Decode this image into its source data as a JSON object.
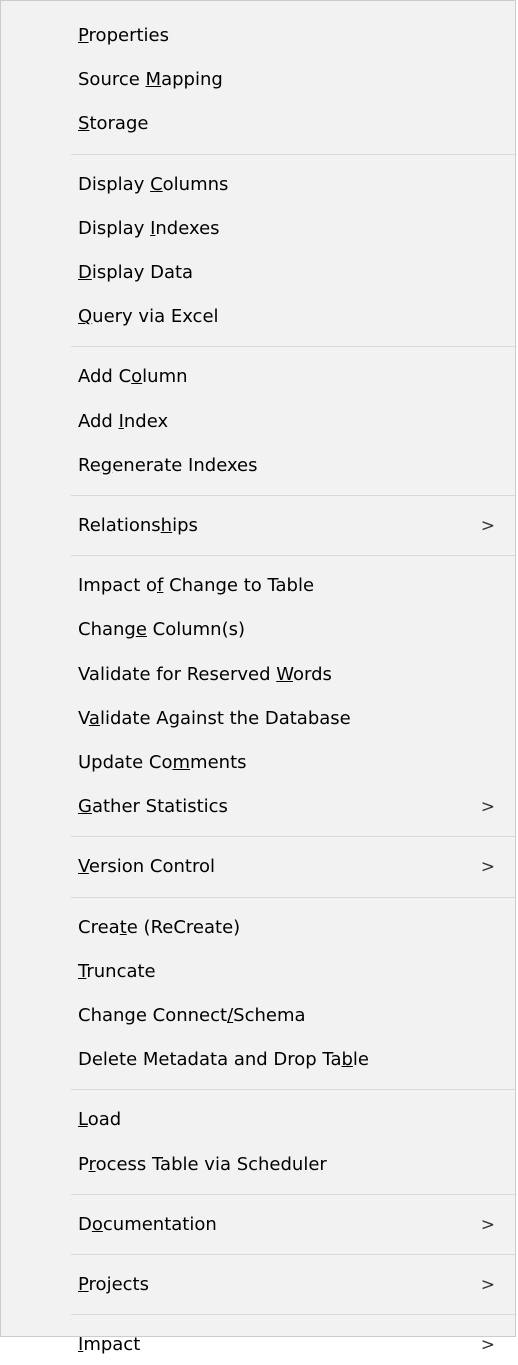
{
  "menu": {
    "groups": [
      {
        "items": [
          {
            "pre": "",
            "key": "P",
            "post": "roperties",
            "submenu": false,
            "arrow": ""
          },
          {
            "pre": "Source ",
            "key": "M",
            "post": "apping",
            "submenu": false,
            "arrow": ""
          },
          {
            "pre": "",
            "key": "S",
            "post": "torage",
            "submenu": false,
            "arrow": ""
          }
        ]
      },
      {
        "items": [
          {
            "pre": "Display ",
            "key": "C",
            "post": "olumns",
            "submenu": false,
            "arrow": ""
          },
          {
            "pre": "Display ",
            "key": "I",
            "post": "ndexes",
            "submenu": false,
            "arrow": ""
          },
          {
            "pre": "",
            "key": "D",
            "post": "isplay Data",
            "submenu": false,
            "arrow": ""
          },
          {
            "pre": "",
            "key": "Q",
            "post": "uery via Excel",
            "submenu": false,
            "arrow": ""
          }
        ]
      },
      {
        "items": [
          {
            "pre": "Add C",
            "key": "o",
            "post": "lumn",
            "submenu": false,
            "arrow": ""
          },
          {
            "pre": "Add ",
            "key": "I",
            "post": "ndex",
            "submenu": false,
            "arrow": ""
          },
          {
            "pre": "Re",
            "key": "g",
            "post": "enerate Indexes",
            "submenu": false,
            "arrow": ""
          }
        ]
      },
      {
        "items": [
          {
            "pre": "Relations",
            "key": "h",
            "post": "ips",
            "submenu": true,
            "arrow": ">"
          }
        ]
      },
      {
        "items": [
          {
            "pre": "Impact o",
            "key": "f",
            "post": " Change to Table",
            "submenu": false,
            "arrow": ""
          },
          {
            "pre": "Chang",
            "key": "e",
            "post": " Column(s)",
            "submenu": false,
            "arrow": ""
          },
          {
            "pre": "Validate for Reserved ",
            "key": "W",
            "post": "ords",
            "submenu": false,
            "arrow": ""
          },
          {
            "pre": "V",
            "key": "a",
            "post": "lidate Against the Database",
            "submenu": false,
            "arrow": ""
          },
          {
            "pre": "Update Co",
            "key": "m",
            "post": "ments",
            "submenu": false,
            "arrow": ""
          },
          {
            "pre": "",
            "key": "G",
            "post": "ather Statistics",
            "submenu": true,
            "arrow": ">"
          }
        ]
      },
      {
        "items": [
          {
            "pre": "",
            "key": "V",
            "post": "ersion Control",
            "submenu": true,
            "arrow": ">"
          }
        ]
      },
      {
        "items": [
          {
            "pre": "Crea",
            "key": "t",
            "post": "e (ReCreate)",
            "submenu": false,
            "arrow": ""
          },
          {
            "pre": "",
            "key": "T",
            "post": "runcate",
            "submenu": false,
            "arrow": ""
          },
          {
            "pre": "Change Connect",
            "key": "/",
            "post": "Schema",
            "submenu": false,
            "arrow": ""
          },
          {
            "pre": "Delete Metadata and Drop Ta",
            "key": "b",
            "post": "le",
            "submenu": false,
            "arrow": ""
          }
        ]
      },
      {
        "items": [
          {
            "pre": "",
            "key": "L",
            "post": "oad",
            "submenu": false,
            "arrow": ""
          },
          {
            "pre": "P",
            "key": "r",
            "post": "ocess Table via Scheduler",
            "submenu": false,
            "arrow": ""
          }
        ]
      },
      {
        "items": [
          {
            "pre": "D",
            "key": "o",
            "post": "cumentation",
            "submenu": true,
            "arrow": ">"
          }
        ]
      },
      {
        "items": [
          {
            "pre": "",
            "key": "P",
            "post": "rojects",
            "submenu": true,
            "arrow": ">"
          }
        ]
      },
      {
        "items": [
          {
            "pre": "",
            "key": "I",
            "post": "mpact",
            "submenu": true,
            "arrow": ">"
          }
        ]
      }
    ]
  }
}
